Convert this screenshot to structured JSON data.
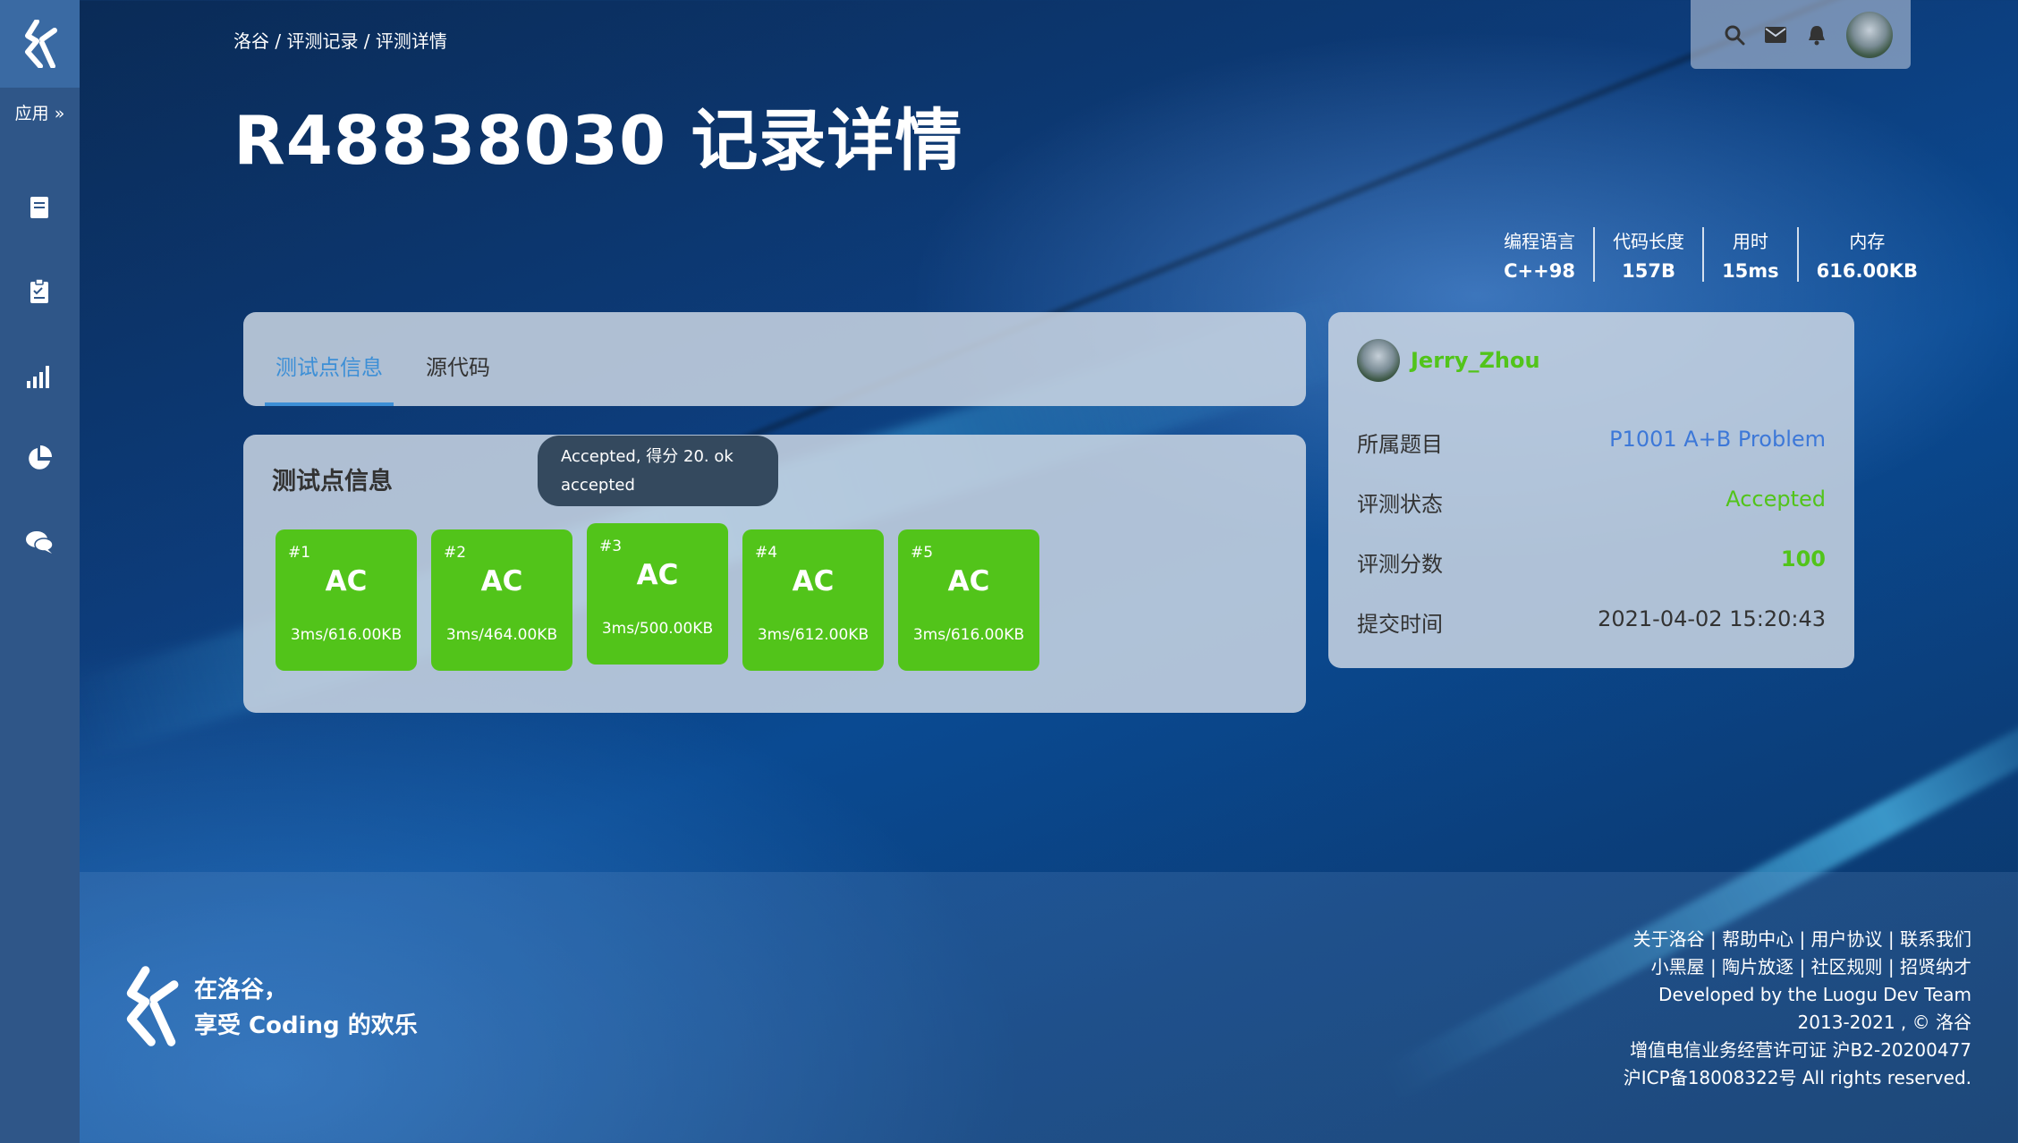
{
  "sidebar": {
    "apps_label": "应用 »",
    "items": [
      {
        "icon": "book-icon"
      },
      {
        "icon": "clipboard-icon"
      },
      {
        "icon": "bar-chart-icon"
      },
      {
        "icon": "pie-chart-icon"
      },
      {
        "icon": "comments-icon"
      }
    ]
  },
  "header": {
    "breadcrumb": "洛谷 / 评测记录 / 评测详情",
    "title": "R48838030 记录详情"
  },
  "stats": [
    {
      "label": "编程语言",
      "value": "C++98"
    },
    {
      "label": "代码长度",
      "value": "157B"
    },
    {
      "label": "用时",
      "value": "15ms"
    },
    {
      "label": "内存",
      "value": "616.00KB"
    }
  ],
  "tabs": {
    "active": "测试点信息",
    "inactive": "源代码"
  },
  "tests": {
    "title": "测试点信息",
    "tooltip_line1": "Accepted, 得分 20. ok",
    "tooltip_line2": "accepted",
    "cases": [
      {
        "num": "#1",
        "status": "AC",
        "info": "3ms/616.00KB"
      },
      {
        "num": "#2",
        "status": "AC",
        "info": "3ms/464.00KB"
      },
      {
        "num": "#3",
        "status": "AC",
        "info": "3ms/500.00KB"
      },
      {
        "num": "#4",
        "status": "AC",
        "info": "3ms/612.00KB"
      },
      {
        "num": "#5",
        "status": "AC",
        "info": "3ms/616.00KB"
      }
    ]
  },
  "record": {
    "author": "Jerry_Zhou",
    "problem_label": "所属题目",
    "problem_value": "P1001 A+B Problem",
    "status_label": "评测状态",
    "status_value": "Accepted",
    "score_label": "评测分数",
    "score_value": "100",
    "time_label": "提交时间",
    "time_value": "2021-04-02 15:20:43"
  },
  "footer": {
    "slogan_line1": "在洛谷，",
    "slogan_line2": "享受 Coding 的欢乐",
    "links_line1": "关于洛谷 | 帮助中心 | 用户协议 | 联系我们",
    "links_line2": "小黑屋 | 陶片放逐 | 社区规则 | 招贤纳才",
    "dev": "Developed by the Luogu Dev Team",
    "copyright": "2013-2021 , © 洛谷",
    "license": "增值电信业务经营许可证 沪B2-20200477",
    "icp": "沪ICP备18008322号 All rights reserved."
  },
  "colors": {
    "accent": "#3d8fd6",
    "ac_green": "#52c41a",
    "sidebar": "#2f5688",
    "tooltip": "#34495e"
  }
}
